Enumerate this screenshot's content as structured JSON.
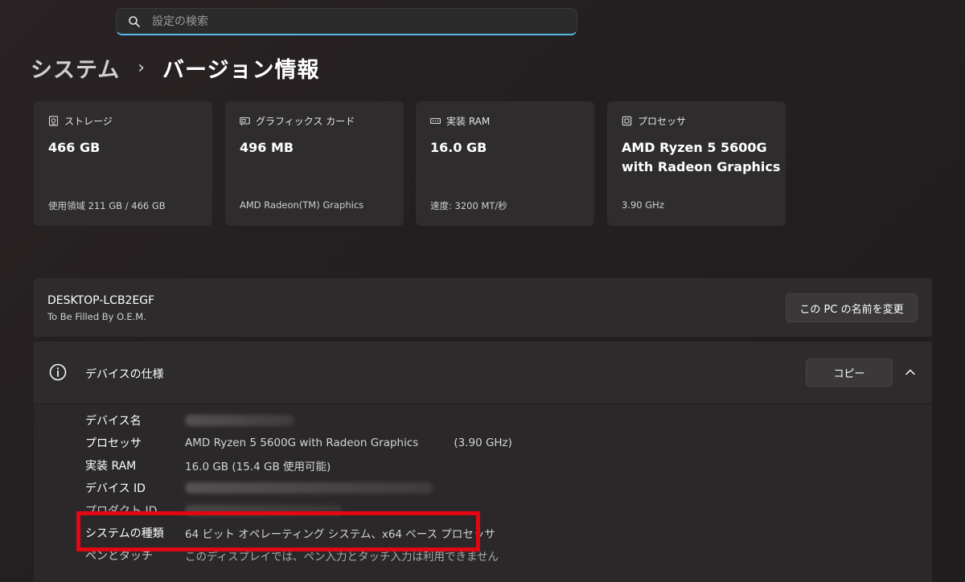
{
  "search": {
    "placeholder": "設定の検索"
  },
  "breadcrumb": {
    "parent": "システム",
    "separator": "›",
    "current": "バージョン情報"
  },
  "cards": [
    {
      "icon": "storage-icon",
      "label": "ストレージ",
      "value": "466 GB",
      "sub": "使用領域 211 GB / 466 GB"
    },
    {
      "icon": "graphics-card-icon",
      "label": "グラフィックス カード",
      "value": "496 MB",
      "sub": "AMD Radeon(TM) Graphics"
    },
    {
      "icon": "ram-icon",
      "label": "実装 RAM",
      "value": "16.0 GB",
      "sub": "速度: 3200 MT/秒"
    },
    {
      "icon": "processor-icon",
      "label": "プロセッサ",
      "value": "AMD Ryzen 5 5600G with Radeon Graphics",
      "sub": "3.90 GHz"
    }
  ],
  "device": {
    "name": "DESKTOP-LCB2EGF",
    "model": "To Be Filled By O.E.M.",
    "rename_label": "この PC の名前を変更"
  },
  "specs": {
    "title": "デバイスの仕様",
    "copy_label": "コピー",
    "rows": [
      {
        "label": "デバイス名",
        "value": "",
        "redacted": true
      },
      {
        "label": "プロセッサ",
        "value": "AMD Ryzen 5 5600G with Radeon Graphics",
        "extra": "(3.90 GHz)"
      },
      {
        "label": "実装 RAM",
        "value": "16.0 GB (15.4 GB 使用可能)"
      },
      {
        "label": "デバイス ID",
        "value": "",
        "redacted": true
      },
      {
        "label": "プロダクト ID",
        "value": "",
        "redacted": true
      },
      {
        "label": "システムの種類",
        "value": "64 ビット オペレーティング システム、x64 ベース プロセッサ"
      },
      {
        "label": "ペンとタッチ",
        "value": "このディスプレイでは、ペン入力とタッチ入力は利用できません"
      }
    ]
  },
  "colors": {
    "accent": "#57b9e6",
    "highlight": "#e30613",
    "card_bg": "#2f2c2d"
  }
}
